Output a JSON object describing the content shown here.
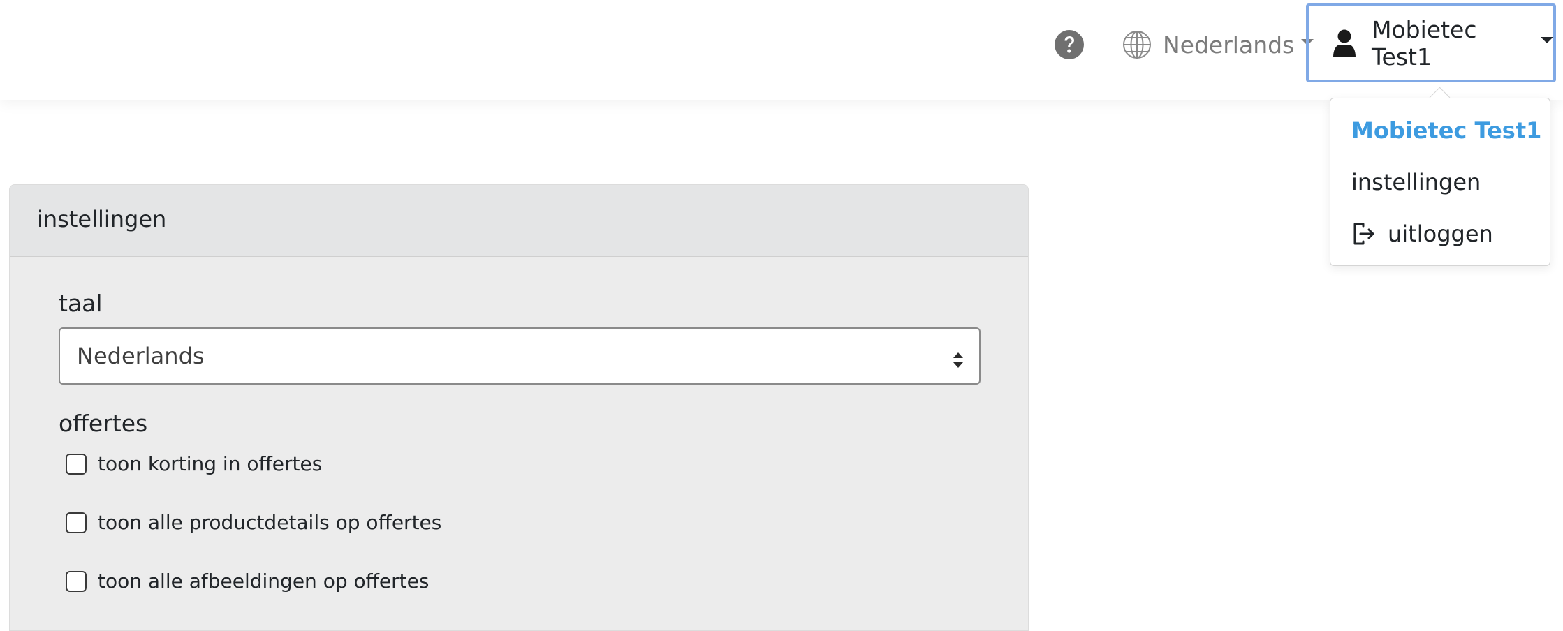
{
  "navbar": {
    "help_icon": "question-circle-icon",
    "language": {
      "icon": "globe-icon",
      "label": "Nederlands"
    },
    "user": {
      "icon": "user-icon",
      "name": "Mobietec Test1"
    }
  },
  "user_menu": {
    "header": "Mobietec Test1",
    "settings_label": "instellingen",
    "logout_label": "uitloggen",
    "logout_icon": "sign-out-icon",
    "header_color": "#3d9be0"
  },
  "panel": {
    "title": "instellingen",
    "language_label": "taal",
    "language_value": "Nederlands",
    "offers_label": "offertes",
    "checkboxes": [
      {
        "label": "toon korting in offertes",
        "checked": false
      },
      {
        "label": "toon alle productdetails op offertes",
        "checked": false
      },
      {
        "label": "toon alle afbeeldingen op offertes",
        "checked": false
      }
    ]
  },
  "colors": {
    "focus_border": "#80a9e6",
    "panel_background": "#ececec"
  }
}
